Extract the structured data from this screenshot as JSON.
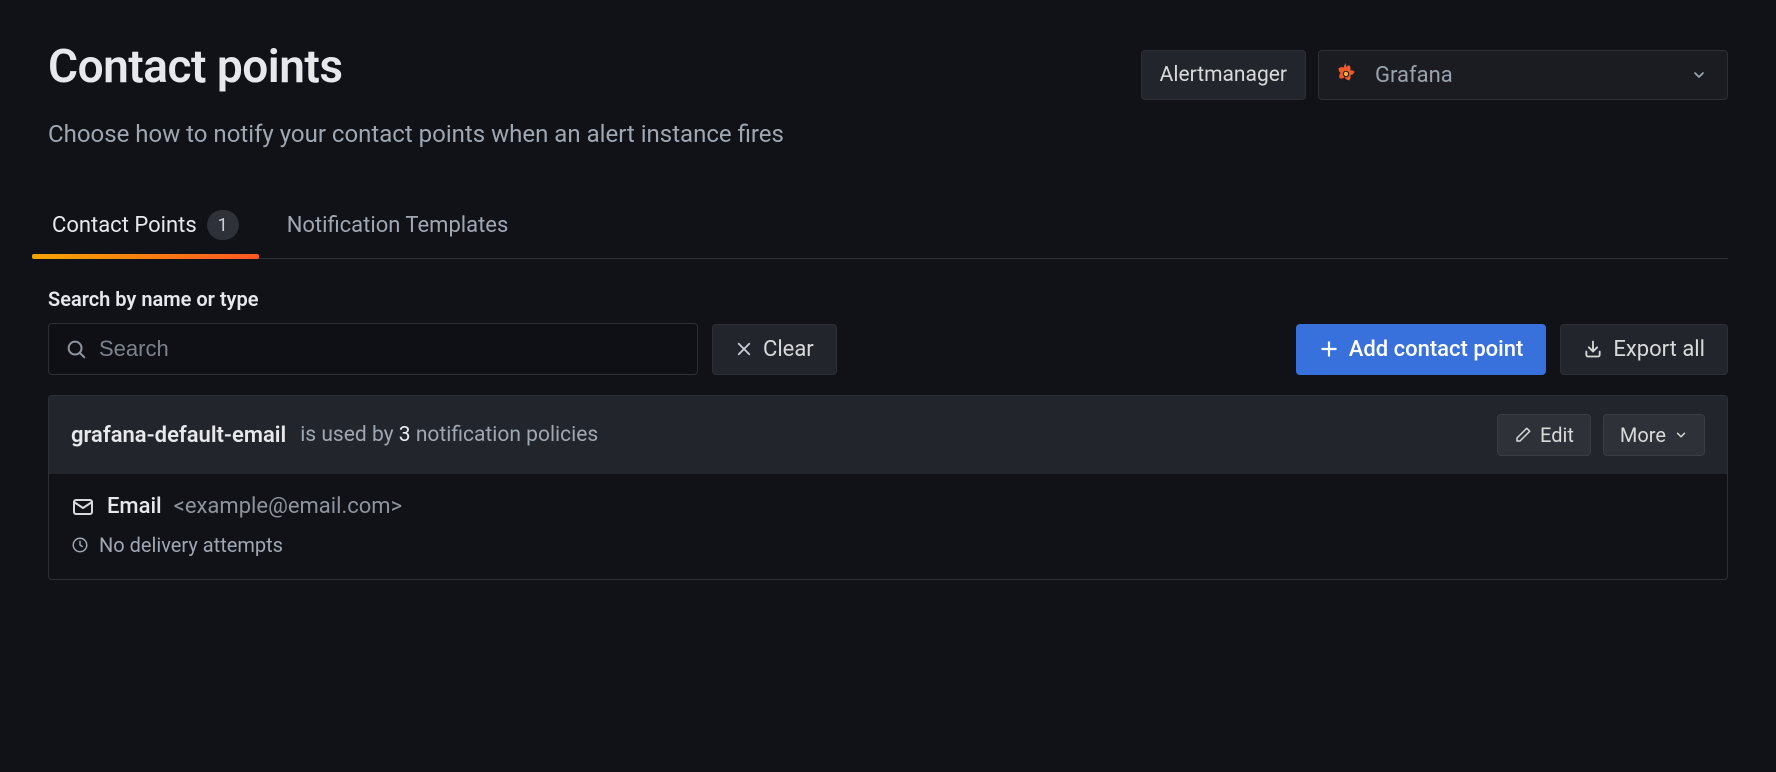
{
  "header": {
    "title": "Contact points",
    "subtitle": "Choose how to notify your contact points when an alert instance fires",
    "alertmanager_label": "Alertmanager",
    "selected_alertmanager": "Grafana"
  },
  "tabs": {
    "contact_points": {
      "label": "Contact Points",
      "count": "1"
    },
    "notification_templates": {
      "label": "Notification Templates"
    }
  },
  "search": {
    "section_label": "Search by name or type",
    "placeholder": "Search",
    "clear_label": "Clear"
  },
  "actions": {
    "add_label": "Add contact point",
    "export_label": "Export all"
  },
  "contact_point": {
    "name": "grafana-default-email",
    "usage_prefix": "is used by ",
    "usage_count": "3",
    "usage_suffix": " notification policies",
    "edit_label": "Edit",
    "more_label": "More",
    "integration": {
      "type": "Email",
      "address": "<example@email.com>",
      "status": "No delivery attempts"
    }
  },
  "colors": {
    "primary": "#3871dc",
    "accent_gradient_start": "#f2a500",
    "accent_gradient_end": "#ff5722"
  }
}
